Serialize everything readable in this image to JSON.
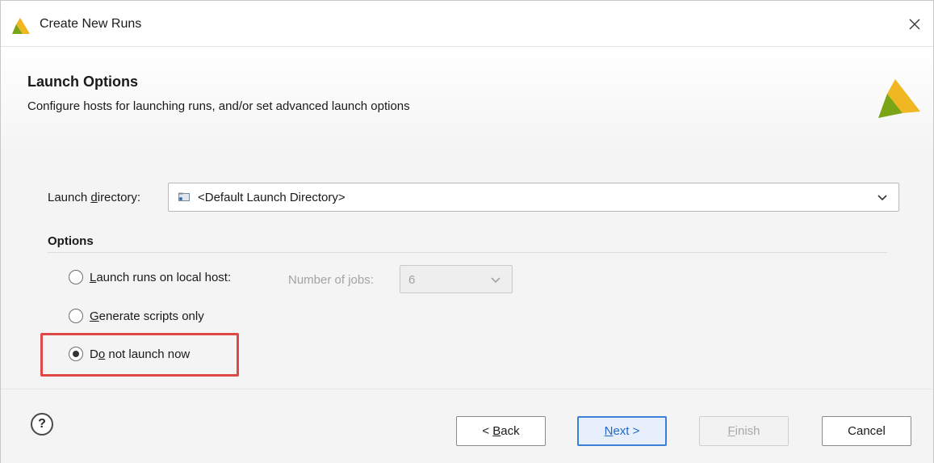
{
  "window": {
    "title": "Create New Runs",
    "close_glyph": "✕"
  },
  "header": {
    "title": "Launch Options",
    "description": "Configure hosts for launching runs, and/or set advanced launch options"
  },
  "launch_directory": {
    "label_pre": "Launch ",
    "label_mnemonic": "d",
    "label_post": "irectory:",
    "value": "<Default Launch Directory>",
    "icon": "folder-icon"
  },
  "options": {
    "title": "Options",
    "items": [
      {
        "mnemonic": "L",
        "label_rest": "aunch runs on local host:",
        "checked": false
      },
      {
        "mnemonic": "G",
        "label_rest": "enerate scripts only",
        "checked": false
      },
      {
        "label_pre": "D",
        "mnemonic": "o",
        "label_rest": " not launch now",
        "checked": true
      }
    ],
    "jobs": {
      "label_pre": "Number of ",
      "label_mnemonic": "j",
      "label_post": "obs:",
      "value": "6",
      "enabled": false
    }
  },
  "footer": {
    "help_glyph": "?",
    "buttons": {
      "back": {
        "prefix": "< ",
        "mnemonic": "B",
        "rest": "ack"
      },
      "next": {
        "mnemonic": "N",
        "rest": "ext >"
      },
      "finish": {
        "mnemonic": "F",
        "rest": "inish",
        "enabled": false
      },
      "cancel": {
        "label": "Cancel"
      }
    }
  },
  "colors": {
    "accent": "#3c7fd9",
    "highlight": "#e04848",
    "logo_green": "#78a416",
    "logo_yellow": "#f0b722"
  }
}
